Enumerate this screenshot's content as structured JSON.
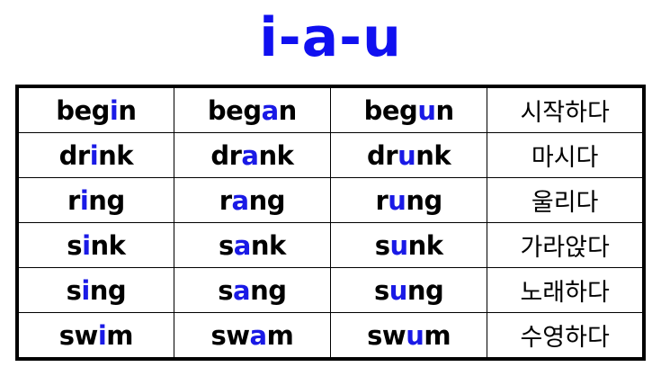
{
  "title": "i-a-u",
  "colors": {
    "title": "#1010f0",
    "vowel_highlight": "#1a1ae6",
    "text": "#000000",
    "border": "#000000",
    "background": "#ffffff"
  },
  "rows": [
    {
      "present": {
        "pre": "beg",
        "vowel": "i",
        "post": "n"
      },
      "past": {
        "pre": "beg",
        "vowel": "a",
        "post": "n"
      },
      "participle": {
        "pre": "beg",
        "vowel": "u",
        "post": "n"
      },
      "meaning": "시작하다"
    },
    {
      "present": {
        "pre": "dr",
        "vowel": "i",
        "post": "nk"
      },
      "past": {
        "pre": "dr",
        "vowel": "a",
        "post": "nk"
      },
      "participle": {
        "pre": "dr",
        "vowel": "u",
        "post": "nk"
      },
      "meaning": "마시다"
    },
    {
      "present": {
        "pre": "r",
        "vowel": "i",
        "post": "ng"
      },
      "past": {
        "pre": "r",
        "vowel": "a",
        "post": "ng"
      },
      "participle": {
        "pre": "r",
        "vowel": "u",
        "post": "ng"
      },
      "meaning": "울리다"
    },
    {
      "present": {
        "pre": "s",
        "vowel": "i",
        "post": "nk"
      },
      "past": {
        "pre": "s",
        "vowel": "a",
        "post": "nk"
      },
      "participle": {
        "pre": "s",
        "vowel": "u",
        "post": "nk"
      },
      "meaning": "가라앉다"
    },
    {
      "present": {
        "pre": "s",
        "vowel": "i",
        "post": "ng"
      },
      "past": {
        "pre": "s",
        "vowel": "a",
        "post": "ng"
      },
      "participle": {
        "pre": "s",
        "vowel": "u",
        "post": "ng"
      },
      "meaning": "노래하다"
    },
    {
      "present": {
        "pre": "sw",
        "vowel": "i",
        "post": "m"
      },
      "past": {
        "pre": "sw",
        "vowel": "a",
        "post": "m"
      },
      "participle": {
        "pre": "sw",
        "vowel": "u",
        "post": "m"
      },
      "meaning": "수영하다"
    }
  ]
}
